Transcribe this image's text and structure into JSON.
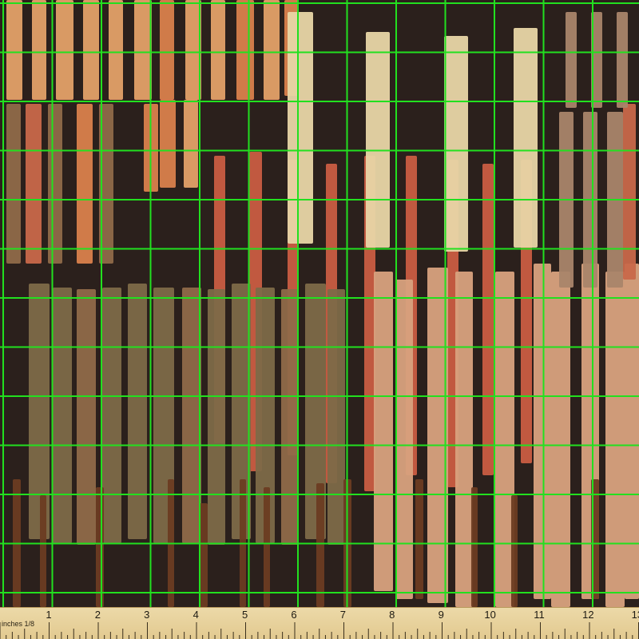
{
  "ruler": {
    "unit_label": "inches 1/8",
    "numbers": [
      "1",
      "2",
      "3",
      "4",
      "5",
      "6",
      "7",
      "8",
      "9",
      "10",
      "11",
      "12",
      "13"
    ]
  },
  "colors": {
    "background": "#2b201c",
    "grid_line": "#22e01f",
    "ruler": "#e9d5a0",
    "stripe_palette": [
      "#e3a168",
      "#d9814c",
      "#c8684a",
      "#8f6a49",
      "#7d6a48",
      "#c95d42",
      "#e8d6a6",
      "#d8a27e",
      "#6c3c22",
      "#a9856a"
    ]
  }
}
